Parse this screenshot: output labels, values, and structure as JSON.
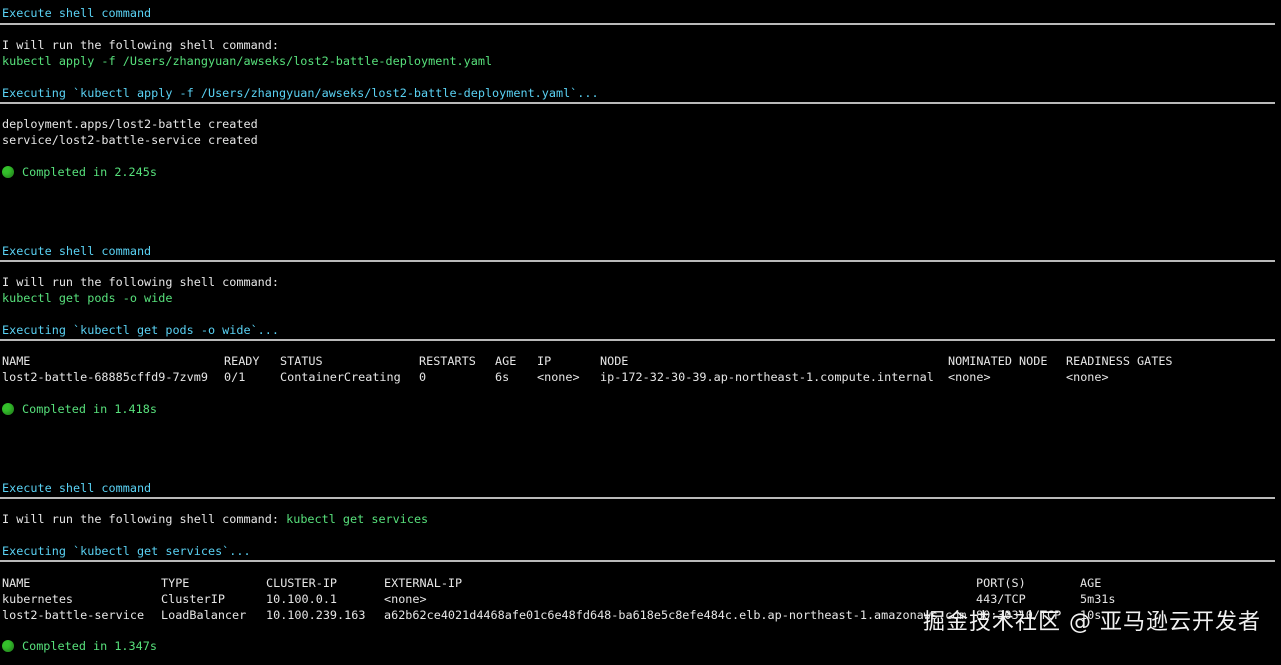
{
  "blocks": [
    {
      "header": "Execute shell command",
      "intro": "I will run the following shell command:",
      "command": "kubectl apply -f /Users/zhangyuan/awseks/lost2-battle-deployment.yaml",
      "executing": "Executing `kubectl apply -f /Users/zhangyuan/awseks/lost2-battle-deployment.yaml`...",
      "output": [
        "deployment.apps/lost2-battle created",
        "service/lost2-battle-service created"
      ],
      "completed": "Completed in 2.245s"
    },
    {
      "header": "Execute shell command",
      "intro": "I will run the following shell command:",
      "command": "kubectl get pods -o wide",
      "executing": "Executing `kubectl get pods -o wide`...",
      "table": {
        "headers": [
          "NAME",
          "READY",
          "STATUS",
          "RESTARTS",
          "AGE",
          "IP",
          "NODE",
          "NOMINATED NODE",
          "READINESS GATES"
        ],
        "rows": [
          [
            "lost2-battle-68885cffd9-7zvm9",
            "0/1",
            "ContainerCreating",
            "0",
            "6s",
            "<none>",
            "ip-172-32-30-39.ap-northeast-1.compute.internal",
            "<none>",
            "<none>"
          ]
        ]
      },
      "completed": "Completed in 1.418s"
    },
    {
      "header": "Execute shell command",
      "intro": "I will run the following shell command:",
      "command": "kubectl get services",
      "executing": "Executing `kubectl get services`...",
      "table": {
        "headers": [
          "NAME",
          "TYPE",
          "CLUSTER-IP",
          "EXTERNAL-IP",
          "PORT(S)",
          "AGE"
        ],
        "rows": [
          [
            "kubernetes",
            "ClusterIP",
            "10.100.0.1",
            "<none>",
            "443/TCP",
            "5m31s"
          ],
          [
            "lost2-battle-service",
            "LoadBalancer",
            "10.100.239.163",
            "a62b62ce4021d4468afe01c6e48fd648-ba618e5c8efe484c.elb.ap-northeast-1.amazonaws.com",
            "80:30310/TCP",
            "10s"
          ]
        ]
      },
      "completed": "Completed in 1.347s"
    }
  ],
  "watermark": "掘金技术社区 @ 亚马逊云开发者",
  "colors": {
    "header": "#5ad2f4",
    "command": "#57e07b",
    "status_dot": "#34c02b"
  },
  "icons": {
    "status": "green-circle-icon"
  }
}
